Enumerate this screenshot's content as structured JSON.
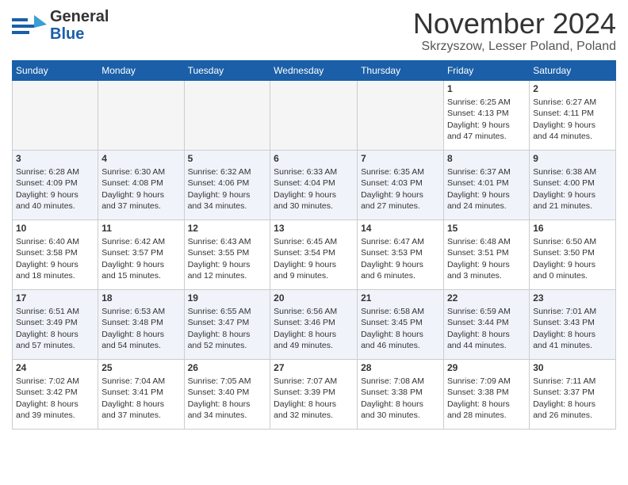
{
  "header": {
    "logo_line1": "General",
    "logo_line2": "Blue",
    "title": "November 2024",
    "subtitle": "Skrzyszow, Lesser Poland, Poland"
  },
  "days_of_week": [
    "Sunday",
    "Monday",
    "Tuesday",
    "Wednesday",
    "Thursday",
    "Friday",
    "Saturday"
  ],
  "weeks": [
    [
      {
        "day": "",
        "info": ""
      },
      {
        "day": "",
        "info": ""
      },
      {
        "day": "",
        "info": ""
      },
      {
        "day": "",
        "info": ""
      },
      {
        "day": "",
        "info": ""
      },
      {
        "day": "1",
        "info": "Sunrise: 6:25 AM\nSunset: 4:13 PM\nDaylight: 9 hours\nand 47 minutes."
      },
      {
        "day": "2",
        "info": "Sunrise: 6:27 AM\nSunset: 4:11 PM\nDaylight: 9 hours\nand 44 minutes."
      }
    ],
    [
      {
        "day": "3",
        "info": "Sunrise: 6:28 AM\nSunset: 4:09 PM\nDaylight: 9 hours\nand 40 minutes."
      },
      {
        "day": "4",
        "info": "Sunrise: 6:30 AM\nSunset: 4:08 PM\nDaylight: 9 hours\nand 37 minutes."
      },
      {
        "day": "5",
        "info": "Sunrise: 6:32 AM\nSunset: 4:06 PM\nDaylight: 9 hours\nand 34 minutes."
      },
      {
        "day": "6",
        "info": "Sunrise: 6:33 AM\nSunset: 4:04 PM\nDaylight: 9 hours\nand 30 minutes."
      },
      {
        "day": "7",
        "info": "Sunrise: 6:35 AM\nSunset: 4:03 PM\nDaylight: 9 hours\nand 27 minutes."
      },
      {
        "day": "8",
        "info": "Sunrise: 6:37 AM\nSunset: 4:01 PM\nDaylight: 9 hours\nand 24 minutes."
      },
      {
        "day": "9",
        "info": "Sunrise: 6:38 AM\nSunset: 4:00 PM\nDaylight: 9 hours\nand 21 minutes."
      }
    ],
    [
      {
        "day": "10",
        "info": "Sunrise: 6:40 AM\nSunset: 3:58 PM\nDaylight: 9 hours\nand 18 minutes."
      },
      {
        "day": "11",
        "info": "Sunrise: 6:42 AM\nSunset: 3:57 PM\nDaylight: 9 hours\nand 15 minutes."
      },
      {
        "day": "12",
        "info": "Sunrise: 6:43 AM\nSunset: 3:55 PM\nDaylight: 9 hours\nand 12 minutes."
      },
      {
        "day": "13",
        "info": "Sunrise: 6:45 AM\nSunset: 3:54 PM\nDaylight: 9 hours\nand 9 minutes."
      },
      {
        "day": "14",
        "info": "Sunrise: 6:47 AM\nSunset: 3:53 PM\nDaylight: 9 hours\nand 6 minutes."
      },
      {
        "day": "15",
        "info": "Sunrise: 6:48 AM\nSunset: 3:51 PM\nDaylight: 9 hours\nand 3 minutes."
      },
      {
        "day": "16",
        "info": "Sunrise: 6:50 AM\nSunset: 3:50 PM\nDaylight: 9 hours\nand 0 minutes."
      }
    ],
    [
      {
        "day": "17",
        "info": "Sunrise: 6:51 AM\nSunset: 3:49 PM\nDaylight: 8 hours\nand 57 minutes."
      },
      {
        "day": "18",
        "info": "Sunrise: 6:53 AM\nSunset: 3:48 PM\nDaylight: 8 hours\nand 54 minutes."
      },
      {
        "day": "19",
        "info": "Sunrise: 6:55 AM\nSunset: 3:47 PM\nDaylight: 8 hours\nand 52 minutes."
      },
      {
        "day": "20",
        "info": "Sunrise: 6:56 AM\nSunset: 3:46 PM\nDaylight: 8 hours\nand 49 minutes."
      },
      {
        "day": "21",
        "info": "Sunrise: 6:58 AM\nSunset: 3:45 PM\nDaylight: 8 hours\nand 46 minutes."
      },
      {
        "day": "22",
        "info": "Sunrise: 6:59 AM\nSunset: 3:44 PM\nDaylight: 8 hours\nand 44 minutes."
      },
      {
        "day": "23",
        "info": "Sunrise: 7:01 AM\nSunset: 3:43 PM\nDaylight: 8 hours\nand 41 minutes."
      }
    ],
    [
      {
        "day": "24",
        "info": "Sunrise: 7:02 AM\nSunset: 3:42 PM\nDaylight: 8 hours\nand 39 minutes."
      },
      {
        "day": "25",
        "info": "Sunrise: 7:04 AM\nSunset: 3:41 PM\nDaylight: 8 hours\nand 37 minutes."
      },
      {
        "day": "26",
        "info": "Sunrise: 7:05 AM\nSunset: 3:40 PM\nDaylight: 8 hours\nand 34 minutes."
      },
      {
        "day": "27",
        "info": "Sunrise: 7:07 AM\nSunset: 3:39 PM\nDaylight: 8 hours\nand 32 minutes."
      },
      {
        "day": "28",
        "info": "Sunrise: 7:08 AM\nSunset: 3:38 PM\nDaylight: 8 hours\nand 30 minutes."
      },
      {
        "day": "29",
        "info": "Sunrise: 7:09 AM\nSunset: 3:38 PM\nDaylight: 8 hours\nand 28 minutes."
      },
      {
        "day": "30",
        "info": "Sunrise: 7:11 AM\nSunset: 3:37 PM\nDaylight: 8 hours\nand 26 minutes."
      }
    ]
  ]
}
